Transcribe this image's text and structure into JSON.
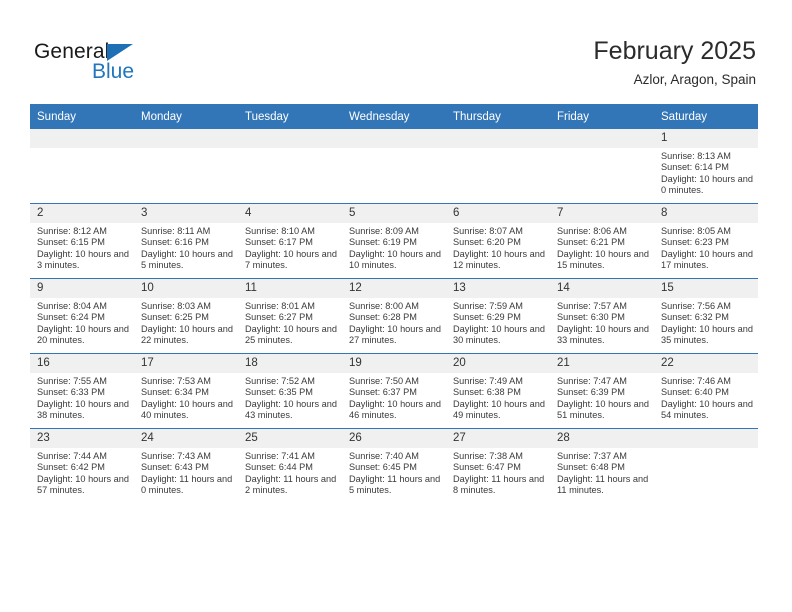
{
  "logo": {
    "word_top": "General",
    "word_bottom": "Blue",
    "triangle_color": "#1f6fb4",
    "blue_color": "#2176bd"
  },
  "header": {
    "title": "February 2025",
    "location": "Azlor, Aragon, Spain"
  },
  "theme": {
    "header_bar": "#3276b8",
    "daynum_band": "#f0f0f0",
    "row_divider": "#3276b8"
  },
  "calendar": {
    "weekday_headers": [
      "Sunday",
      "Monday",
      "Tuesday",
      "Wednesday",
      "Thursday",
      "Friday",
      "Saturday"
    ],
    "labels": {
      "sunrise": "Sunrise:",
      "sunset": "Sunset:",
      "daylight": "Daylight:"
    },
    "weeks": [
      [
        {
          "day": ""
        },
        {
          "day": ""
        },
        {
          "day": ""
        },
        {
          "day": ""
        },
        {
          "day": ""
        },
        {
          "day": ""
        },
        {
          "day": "1",
          "sunrise": "Sunrise: 8:13 AM",
          "sunset": "Sunset: 6:14 PM",
          "daylight": "Daylight: 10 hours and 0 minutes."
        }
      ],
      [
        {
          "day": "2",
          "sunrise": "Sunrise: 8:12 AM",
          "sunset": "Sunset: 6:15 PM",
          "daylight": "Daylight: 10 hours and 3 minutes."
        },
        {
          "day": "3",
          "sunrise": "Sunrise: 8:11 AM",
          "sunset": "Sunset: 6:16 PM",
          "daylight": "Daylight: 10 hours and 5 minutes."
        },
        {
          "day": "4",
          "sunrise": "Sunrise: 8:10 AM",
          "sunset": "Sunset: 6:17 PM",
          "daylight": "Daylight: 10 hours and 7 minutes."
        },
        {
          "day": "5",
          "sunrise": "Sunrise: 8:09 AM",
          "sunset": "Sunset: 6:19 PM",
          "daylight": "Daylight: 10 hours and 10 minutes."
        },
        {
          "day": "6",
          "sunrise": "Sunrise: 8:07 AM",
          "sunset": "Sunset: 6:20 PM",
          "daylight": "Daylight: 10 hours and 12 minutes."
        },
        {
          "day": "7",
          "sunrise": "Sunrise: 8:06 AM",
          "sunset": "Sunset: 6:21 PM",
          "daylight": "Daylight: 10 hours and 15 minutes."
        },
        {
          "day": "8",
          "sunrise": "Sunrise: 8:05 AM",
          "sunset": "Sunset: 6:23 PM",
          "daylight": "Daylight: 10 hours and 17 minutes."
        }
      ],
      [
        {
          "day": "9",
          "sunrise": "Sunrise: 8:04 AM",
          "sunset": "Sunset: 6:24 PM",
          "daylight": "Daylight: 10 hours and 20 minutes."
        },
        {
          "day": "10",
          "sunrise": "Sunrise: 8:03 AM",
          "sunset": "Sunset: 6:25 PM",
          "daylight": "Daylight: 10 hours and 22 minutes."
        },
        {
          "day": "11",
          "sunrise": "Sunrise: 8:01 AM",
          "sunset": "Sunset: 6:27 PM",
          "daylight": "Daylight: 10 hours and 25 minutes."
        },
        {
          "day": "12",
          "sunrise": "Sunrise: 8:00 AM",
          "sunset": "Sunset: 6:28 PM",
          "daylight": "Daylight: 10 hours and 27 minutes."
        },
        {
          "day": "13",
          "sunrise": "Sunrise: 7:59 AM",
          "sunset": "Sunset: 6:29 PM",
          "daylight": "Daylight: 10 hours and 30 minutes."
        },
        {
          "day": "14",
          "sunrise": "Sunrise: 7:57 AM",
          "sunset": "Sunset: 6:30 PM",
          "daylight": "Daylight: 10 hours and 33 minutes."
        },
        {
          "day": "15",
          "sunrise": "Sunrise: 7:56 AM",
          "sunset": "Sunset: 6:32 PM",
          "daylight": "Daylight: 10 hours and 35 minutes."
        }
      ],
      [
        {
          "day": "16",
          "sunrise": "Sunrise: 7:55 AM",
          "sunset": "Sunset: 6:33 PM",
          "daylight": "Daylight: 10 hours and 38 minutes."
        },
        {
          "day": "17",
          "sunrise": "Sunrise: 7:53 AM",
          "sunset": "Sunset: 6:34 PM",
          "daylight": "Daylight: 10 hours and 40 minutes."
        },
        {
          "day": "18",
          "sunrise": "Sunrise: 7:52 AM",
          "sunset": "Sunset: 6:35 PM",
          "daylight": "Daylight: 10 hours and 43 minutes."
        },
        {
          "day": "19",
          "sunrise": "Sunrise: 7:50 AM",
          "sunset": "Sunset: 6:37 PM",
          "daylight": "Daylight: 10 hours and 46 minutes."
        },
        {
          "day": "20",
          "sunrise": "Sunrise: 7:49 AM",
          "sunset": "Sunset: 6:38 PM",
          "daylight": "Daylight: 10 hours and 49 minutes."
        },
        {
          "day": "21",
          "sunrise": "Sunrise: 7:47 AM",
          "sunset": "Sunset: 6:39 PM",
          "daylight": "Daylight: 10 hours and 51 minutes."
        },
        {
          "day": "22",
          "sunrise": "Sunrise: 7:46 AM",
          "sunset": "Sunset: 6:40 PM",
          "daylight": "Daylight: 10 hours and 54 minutes."
        }
      ],
      [
        {
          "day": "23",
          "sunrise": "Sunrise: 7:44 AM",
          "sunset": "Sunset: 6:42 PM",
          "daylight": "Daylight: 10 hours and 57 minutes."
        },
        {
          "day": "24",
          "sunrise": "Sunrise: 7:43 AM",
          "sunset": "Sunset: 6:43 PM",
          "daylight": "Daylight: 11 hours and 0 minutes."
        },
        {
          "day": "25",
          "sunrise": "Sunrise: 7:41 AM",
          "sunset": "Sunset: 6:44 PM",
          "daylight": "Daylight: 11 hours and 2 minutes."
        },
        {
          "day": "26",
          "sunrise": "Sunrise: 7:40 AM",
          "sunset": "Sunset: 6:45 PM",
          "daylight": "Daylight: 11 hours and 5 minutes."
        },
        {
          "day": "27",
          "sunrise": "Sunrise: 7:38 AM",
          "sunset": "Sunset: 6:47 PM",
          "daylight": "Daylight: 11 hours and 8 minutes."
        },
        {
          "day": "28",
          "sunrise": "Sunrise: 7:37 AM",
          "sunset": "Sunset: 6:48 PM",
          "daylight": "Daylight: 11 hours and 11 minutes."
        },
        {
          "day": ""
        }
      ]
    ]
  }
}
